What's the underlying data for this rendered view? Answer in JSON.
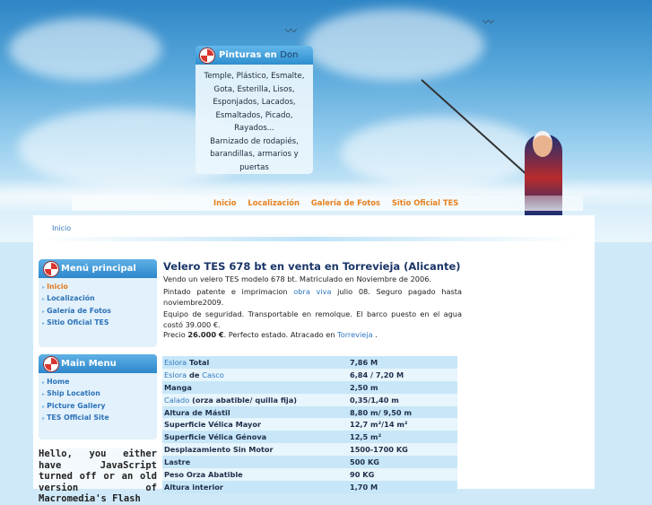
{
  "header": {
    "pinturas_box": {
      "title": "Pinturas en",
      "title_suffix": "Don",
      "lines": [
        "Temple, Plástico, Esmalte,",
        "Gota, Esterilla, Lisos,",
        "Esponjados, Lacados,",
        "Esmaltados, Picado,",
        "Rayados...",
        "Barnizado de rodapiés,",
        "barandillas, armarios y puertas"
      ]
    },
    "nav": [
      "Inicio",
      "Localización",
      "Galería de Fotos",
      "Sitio Oficial TES"
    ]
  },
  "breadcrumb": "Inicio",
  "sidebar": {
    "menu_principal": {
      "title": "Menú principal",
      "items": [
        {
          "label": "Inicio",
          "active": true
        },
        {
          "label": "Localización",
          "active": false
        },
        {
          "label": "Galería de Fotos",
          "active": false
        },
        {
          "label": "Sitio Oficial TES",
          "active": false
        }
      ]
    },
    "main_menu": {
      "title": "Main Menu",
      "items": [
        {
          "label": "Home"
        },
        {
          "label": "Ship Location"
        },
        {
          "label": "Picture Gallery"
        },
        {
          "label": "TES Official Site"
        }
      ]
    },
    "flash_notice": "Hello, you either have JavaScript turned off or an old version of Macromedia's Flash"
  },
  "content": {
    "title": "Velero TES 678 bt en venta en Torrevieja (Alicante)",
    "p1": "Vendo un velero TES modelo 678 bt. Matriculado en Noviembre de 2006.",
    "p2_a": "Pintado patente e imprimacion",
    "p2_link": "obra viva",
    "p2_b": "julio 08. Seguro pagado hasta noviembre2009.",
    "p3": "Equipo de seguridad. Transportable en remolque. El barco puesto en el agua costó 39.000 €.",
    "p4_a": "Precio",
    "p4_price": "26.000 €",
    "p4_b": ". Perfecto estado. Atracado en",
    "p4_link": "Torrevieja",
    "p4_c": ".",
    "specs": [
      {
        "k_link": "Eslora",
        "k_join": "",
        "k_rest": "Total",
        "v": "7,86 M"
      },
      {
        "k_link": "Eslora",
        "k_join": "de",
        "k_link2": "Casco",
        "v": "6,84 / 7,20 M"
      },
      {
        "k_rest": "Manga",
        "v": "2,50 m"
      },
      {
        "k_link": "Calado",
        "k_rest": "(orza abatible/ quilla fija)",
        "v": "0,35/1,40 m"
      },
      {
        "k_rest": "Altura de Mástil",
        "v": "8,80 m/ 9,50 m"
      },
      {
        "k_rest": "Superficie Vélica Mayor",
        "v": "12,7 m²/14 m²"
      },
      {
        "k_rest": "Superficie Vélica Génova",
        "v": "12,5 m²"
      },
      {
        "k_rest": "Desplazamiento Sin Motor",
        "v": "1500-1700 KG"
      },
      {
        "k_rest": "Lastre",
        "v": "500 KG"
      },
      {
        "k_rest": "Peso Orza Abatible",
        "v": "90 KG"
      },
      {
        "k_rest": "Altura interior",
        "v": "1,70 M"
      }
    ]
  }
}
